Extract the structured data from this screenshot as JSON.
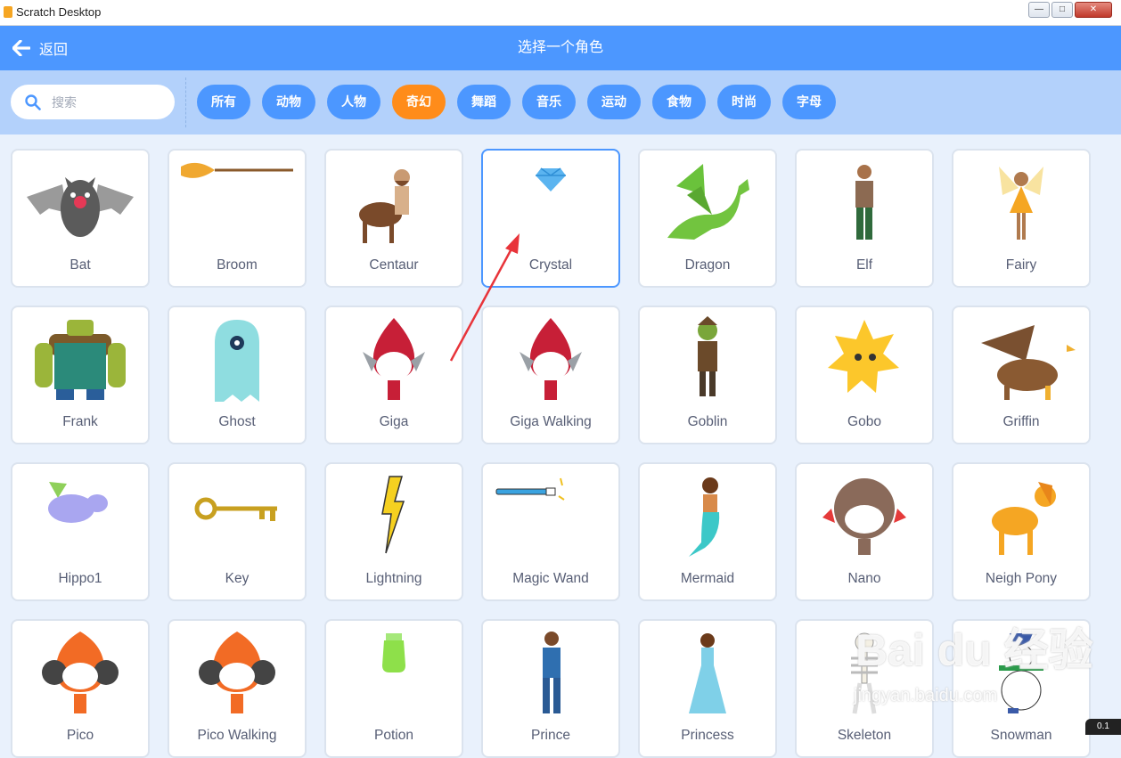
{
  "window": {
    "title": "Scratch Desktop",
    "min": "—",
    "max": "□",
    "close": "✕"
  },
  "header": {
    "back_label": "返回",
    "title": "选择一个角色"
  },
  "search": {
    "placeholder": "搜索",
    "value": ""
  },
  "tags": [
    {
      "label": "所有",
      "active": false
    },
    {
      "label": "动物",
      "active": false
    },
    {
      "label": "人物",
      "active": false
    },
    {
      "label": "奇幻",
      "active": true
    },
    {
      "label": "舞蹈",
      "active": false
    },
    {
      "label": "音乐",
      "active": false
    },
    {
      "label": "运动",
      "active": false
    },
    {
      "label": "食物",
      "active": false
    },
    {
      "label": "时尚",
      "active": false
    },
    {
      "label": "字母",
      "active": false
    }
  ],
  "sprites": [
    {
      "name": "Bat",
      "icon": "bat-icon"
    },
    {
      "name": "Broom",
      "icon": "broom-icon"
    },
    {
      "name": "Centaur",
      "icon": "centaur-icon"
    },
    {
      "name": "Crystal",
      "icon": "crystal-icon"
    },
    {
      "name": "Dragon",
      "icon": "dragon-icon"
    },
    {
      "name": "Elf",
      "icon": "elf-icon"
    },
    {
      "name": "Fairy",
      "icon": "fairy-icon"
    },
    {
      "name": "Frank",
      "icon": "frank-icon"
    },
    {
      "name": "Ghost",
      "icon": "ghost-icon"
    },
    {
      "name": "Giga",
      "icon": "giga-icon"
    },
    {
      "name": "Giga Walking",
      "icon": "giga-walking-icon"
    },
    {
      "name": "Goblin",
      "icon": "goblin-icon"
    },
    {
      "name": "Gobo",
      "icon": "gobo-icon"
    },
    {
      "name": "Griffin",
      "icon": "griffin-icon"
    },
    {
      "name": "Hippo1",
      "icon": "hippo-icon"
    },
    {
      "name": "Key",
      "icon": "key-icon"
    },
    {
      "name": "Lightning",
      "icon": "lightning-icon"
    },
    {
      "name": "Magic Wand",
      "icon": "magic-wand-icon"
    },
    {
      "name": "Mermaid",
      "icon": "mermaid-icon"
    },
    {
      "name": "Nano",
      "icon": "nano-icon"
    },
    {
      "name": "Neigh Pony",
      "icon": "pony-icon"
    },
    {
      "name": "Pico",
      "icon": "pico-icon"
    },
    {
      "name": "Pico Walking",
      "icon": "pico-walking-icon"
    },
    {
      "name": "Potion",
      "icon": "potion-icon"
    },
    {
      "name": "Prince",
      "icon": "prince-icon"
    },
    {
      "name": "Princess",
      "icon": "princess-icon"
    },
    {
      "name": "Skeleton",
      "icon": "skeleton-icon"
    },
    {
      "name": "Snowman",
      "icon": "snowman-icon"
    }
  ],
  "selected_sprite": "Crystal",
  "watermark": {
    "main": "Bai du 经验",
    "sub": "jingyan.baidu.com"
  },
  "net_badge": "0.1",
  "colors": {
    "primary": "#4c97ff",
    "active_tag": "#ff8c1a",
    "filter_bg": "#b3d1fb",
    "page_bg": "#e9f1fc",
    "text": "#575e75"
  }
}
